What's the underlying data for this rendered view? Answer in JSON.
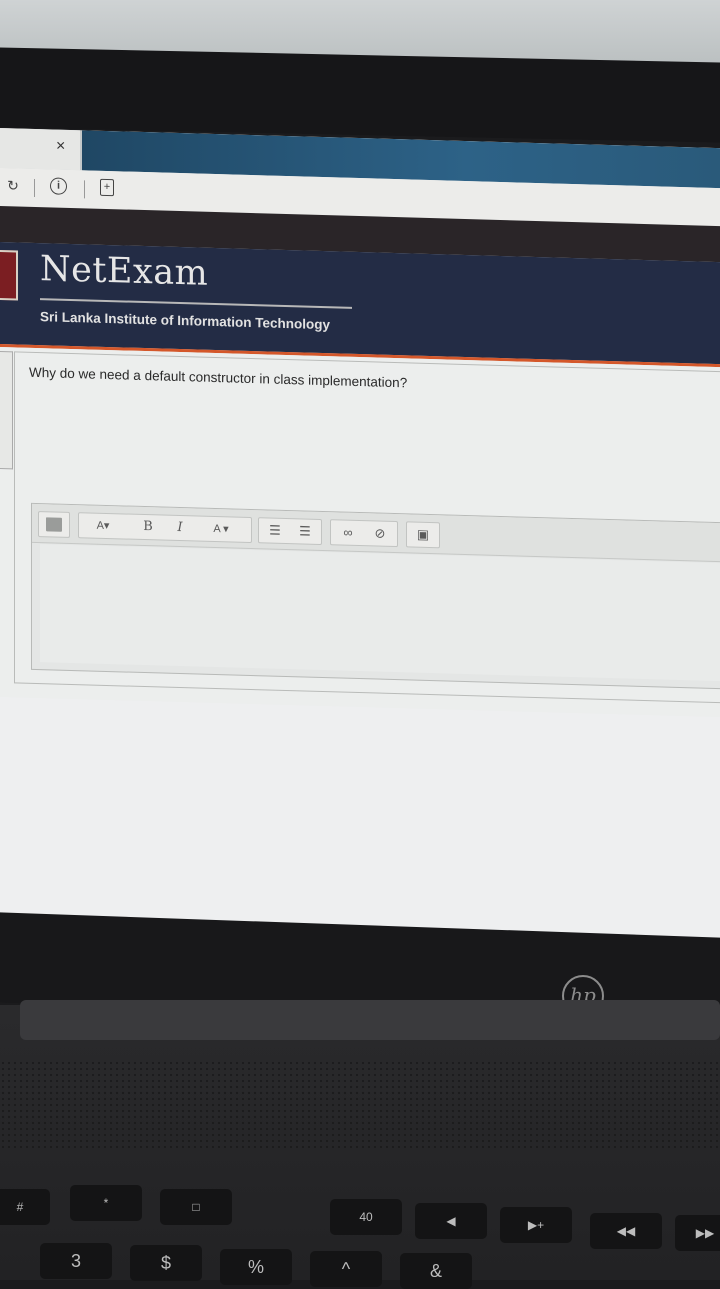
{
  "browser": {
    "close_glyph": "×",
    "reload_glyph": "↻",
    "info_glyph": "i",
    "page_glyph": "+"
  },
  "header": {
    "brand": "NetExam",
    "subtitle": "Sri Lanka Institute of Information Technology"
  },
  "question": {
    "text": "Why do we need a default constructor in class implementation?"
  },
  "editor": {
    "toolbar": {
      "toggle_label": "",
      "paragraph_styles": "A▾",
      "bold": "B",
      "italic": "I",
      "font_color": "A ▾",
      "unordered_list": "☰",
      "ordered_list": "☰",
      "link": "∞",
      "unlink": "⊘",
      "image": "▣"
    },
    "answer_value": ""
  },
  "laptop": {
    "brand": "hp"
  },
  "colors": {
    "header_bg": "#232c45",
    "accent_orange": "#d4572a",
    "tab_blue": "#2d6287"
  },
  "keyboard": {
    "keys": [
      "#",
      "*",
      "□",
      "40",
      "◀",
      "▶+",
      "◀◀",
      "▶▶",
      "3",
      "$",
      "%",
      "^",
      "&"
    ]
  }
}
